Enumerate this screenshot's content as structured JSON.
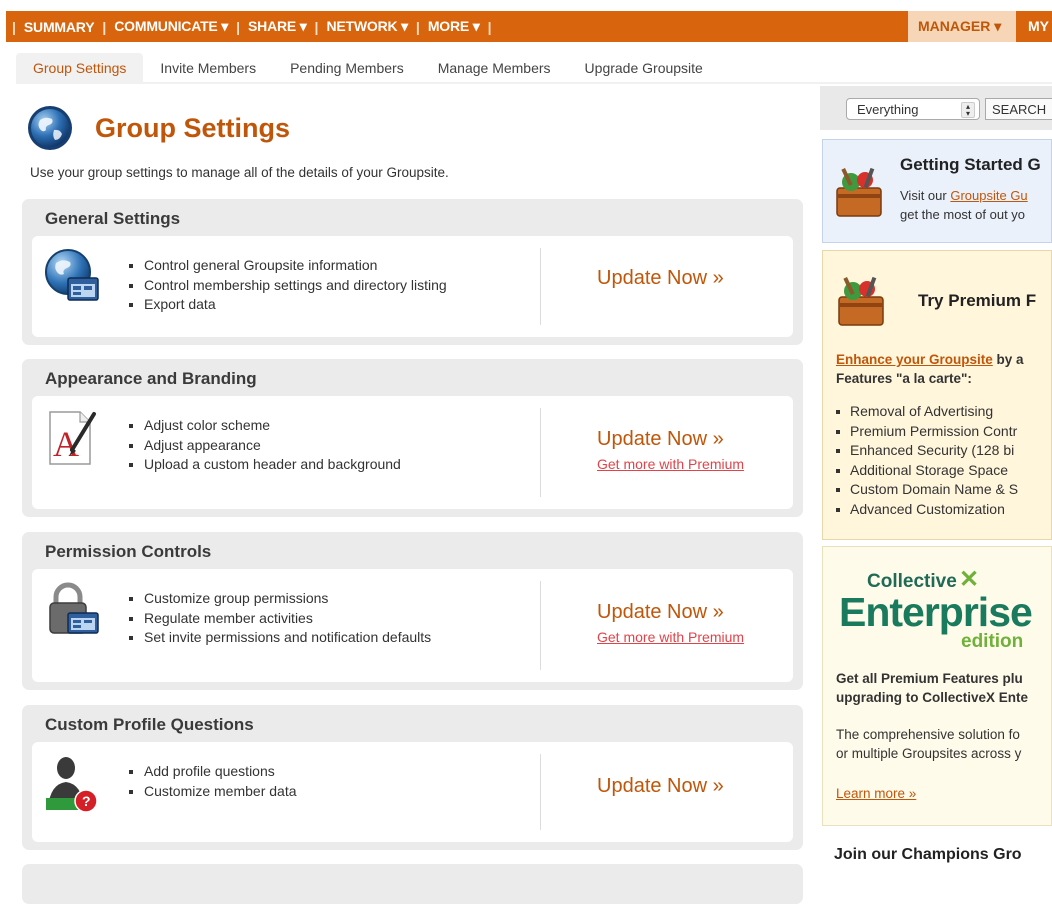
{
  "topnav": {
    "items": [
      "SUMMARY",
      "COMMUNICATE ▾",
      "SHARE ▾",
      "NETWORK ▾",
      "MORE ▾"
    ],
    "manager": "MANAGER ▾",
    "my": "MY"
  },
  "subtabs": [
    "Group Settings",
    "Invite Members",
    "Pending Members",
    "Manage Members",
    "Upgrade Groupsite"
  ],
  "page": {
    "title": "Group Settings",
    "intro": "Use your group settings to manage all of the details of your Groupsite."
  },
  "sections": [
    {
      "title": "General Settings",
      "bullets": [
        "Control general Groupsite information",
        "Control membership settings and directory listing",
        "Export data"
      ],
      "update": "Update Now »",
      "premium": ""
    },
    {
      "title": "Appearance and Branding",
      "bullets": [
        "Adjust color scheme",
        "Adjust appearance",
        "Upload a custom header and background"
      ],
      "update": "Update Now »",
      "premium": "Get more with Premium"
    },
    {
      "title": "Permission Controls",
      "bullets": [
        "Customize group permissions",
        "Regulate member activities",
        "Set invite permissions and notification defaults"
      ],
      "update": "Update Now »",
      "premium": "Get more with Premium"
    },
    {
      "title": "Custom Profile Questions",
      "bullets": [
        "Add profile questions",
        "Customize member data"
      ],
      "update": "Update Now »",
      "premium": ""
    }
  ],
  "sidebar": {
    "search_select": "Everything",
    "search_button": "SEARCH",
    "getting_started": {
      "title": "Getting Started G",
      "text_pre": "Visit our ",
      "link": "Groupsite Gu",
      "text_post": "get the most of out yo"
    },
    "premium": {
      "title": "Try Premium F",
      "link": "Enhance your Groupsite",
      "text1": " by a",
      "text2": "Features \"a la carte\":",
      "items": [
        "Removal of Advertising",
        "Premium Permission Contr",
        "Enhanced Security (128 bi",
        "Additional Storage Space",
        "Custom Domain Name & S",
        "Advanced Customization"
      ]
    },
    "enterprise": {
      "logo_top": "Collective",
      "logo_main": "Enterprise",
      "logo_sub": "edition",
      "bold1": "Get all Premium Features plu",
      "bold2": "upgrading to CollectiveX Ente",
      "text1": "The comprehensive solution fo",
      "text2": "or multiple Groupsites across y",
      "link": "Learn more »"
    },
    "champions": "Join our Champions Gro"
  },
  "colors": {
    "brand_orange": "#d8650d",
    "accent_text": "#c0560a",
    "premium_red": "#e0444a"
  }
}
